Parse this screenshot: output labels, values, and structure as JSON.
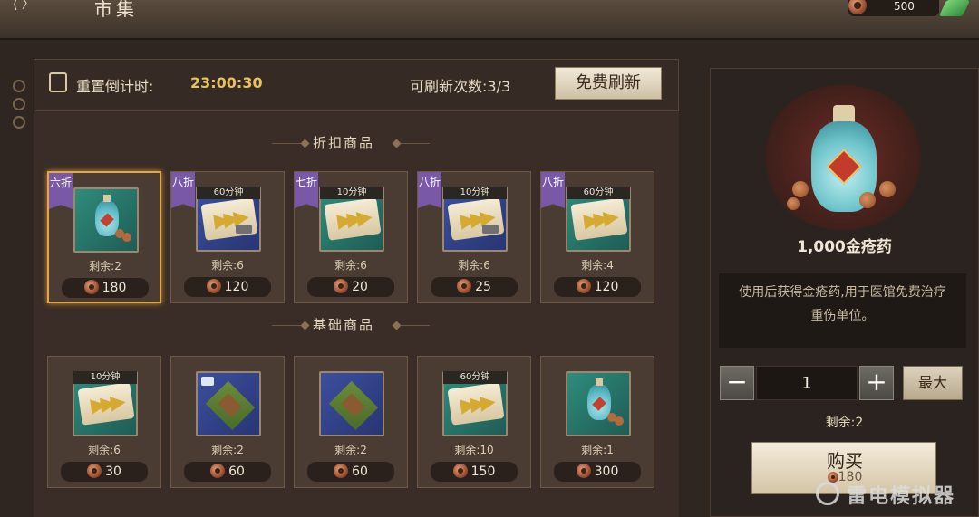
{
  "header": {
    "back_glyph": "⟨ 〉",
    "title": "市集",
    "currency_value": "500"
  },
  "timer": {
    "label": "重置倒计时:",
    "value": "23:00:30",
    "refresh_label": "可刷新次数:3/3",
    "free_refresh": "免费刷新"
  },
  "sections": {
    "discount_title": "折扣商品",
    "basic_title": "基础商品"
  },
  "discount_items": [
    {
      "tag": "六折",
      "time": "",
      "icon": "potion-icon",
      "remain": "剩余:2",
      "price": "180",
      "selected": true
    },
    {
      "tag": "八折",
      "time": "60分钟",
      "icon": "speedup-scroll-hammer-icon",
      "remain": "剩余:6",
      "price": "120"
    },
    {
      "tag": "七折",
      "time": "10分钟",
      "icon": "speedup-scroll-icon",
      "remain": "剩余:6",
      "price": "20"
    },
    {
      "tag": "八折",
      "time": "10分钟",
      "icon": "speedup-scroll-hammer-icon",
      "remain": "剩余:6",
      "price": "25"
    },
    {
      "tag": "八折",
      "time": "60分钟",
      "icon": "speedup-scroll-icon",
      "remain": "剩余:4",
      "price": "120"
    }
  ],
  "basic_items": [
    {
      "time": "10分钟",
      "icon": "speedup-scroll-icon",
      "remain": "剩余:6",
      "price": "30"
    },
    {
      "time": "",
      "icon": "town-build-icon",
      "remain": "剩余:2",
      "price": "60"
    },
    {
      "time": "",
      "icon": "town-farm-icon",
      "remain": "剩余:2",
      "price": "60"
    },
    {
      "time": "60分钟",
      "icon": "speedup-scroll-icon",
      "remain": "剩余:10",
      "price": "150"
    },
    {
      "time": "",
      "icon": "potion-icon",
      "remain": "剩余:1",
      "price": "300"
    }
  ],
  "detail": {
    "name": "1,000金疮药",
    "description": "使用后获得金疮药,用于医馆免费治疗重伤单位。",
    "quantity": "1",
    "minus": "−",
    "plus": "+",
    "max": "最大",
    "remain": "剩余:2",
    "buy_label": "购买",
    "buy_price": "180"
  },
  "watermark": "雷电模拟器",
  "colors": {
    "accent_gold": "#e9c25c",
    "discount_tag": "#7a58a8",
    "selected_border": "#e1a748"
  }
}
